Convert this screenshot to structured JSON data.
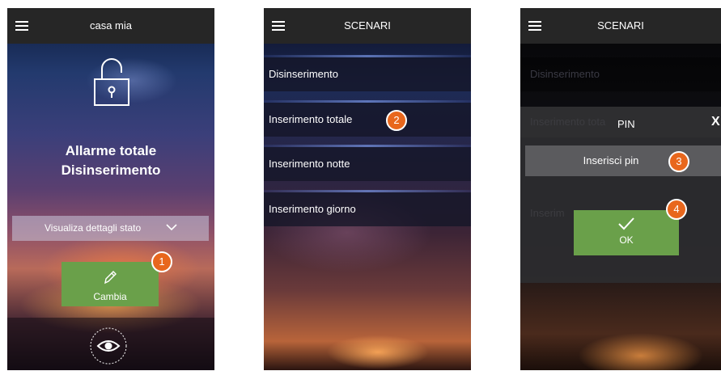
{
  "screen1": {
    "title": "casa mia",
    "alarm_title": "Allarme totale",
    "alarm_status": "Disinserimento",
    "details_label": "Visualiza dettagli stato",
    "change_label": "Cambia",
    "badge": "1"
  },
  "screen2": {
    "title": "SCENARI",
    "items": [
      {
        "label": "Disinserimento"
      },
      {
        "label": "Inserimento totale"
      },
      {
        "label": "Inserimento notte"
      },
      {
        "label": "Inserimento giorno"
      }
    ],
    "badge": "2"
  },
  "screen3": {
    "title": "SCENARI",
    "dimmed_items": [
      {
        "label": "Disinserimento"
      },
      {
        "label": "Inserimento tota"
      },
      {
        "label": "Inserim"
      }
    ],
    "pin_title": "PIN",
    "close_label": "X",
    "pin_placeholder": "Inserisci pin",
    "ok_label": "OK",
    "badge_pin": "3",
    "badge_ok": "4"
  },
  "colors": {
    "accent_green": "#6aa04a",
    "badge_orange": "#e8671d",
    "topbar": "#262626"
  },
  "icons": [
    "menu-icon",
    "lock-open-icon",
    "chevron-down-icon",
    "pencil-icon",
    "eye-icon",
    "check-icon",
    "close-icon"
  ]
}
